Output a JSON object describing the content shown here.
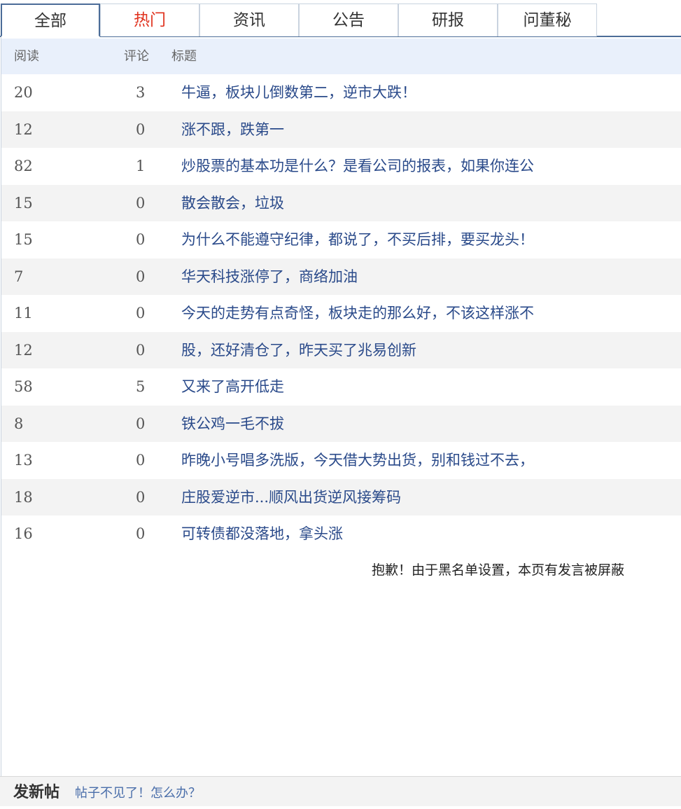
{
  "tabs": [
    {
      "label": "全部",
      "active": true
    },
    {
      "label": "热门",
      "highlight": true
    },
    {
      "label": "资讯"
    },
    {
      "label": "公告"
    },
    {
      "label": "研报"
    },
    {
      "label": "问董秘"
    }
  ],
  "table": {
    "headers": {
      "read": "阅读",
      "comment": "评论",
      "title": "标题"
    },
    "rows": [
      {
        "read": "20",
        "comment": "3",
        "title": "牛逼，板块儿倒数第二，逆市大跌！"
      },
      {
        "read": "12",
        "comment": "0",
        "title": "涨不跟，跌第一"
      },
      {
        "read": "82",
        "comment": "1",
        "title": "炒股票的基本功是什么？是看公司的报表，如果你连公"
      },
      {
        "read": "15",
        "comment": "0",
        "title": "散会散会，垃圾"
      },
      {
        "read": "15",
        "comment": "0",
        "title": "为什么不能遵守纪律，都说了，不买后排，要买龙头！"
      },
      {
        "read": "7",
        "comment": "0",
        "title": "华天科技涨停了，商络加油"
      },
      {
        "read": "11",
        "comment": "0",
        "title": "今天的走势有点奇怪，板块走的那么好，不该这样涨不"
      },
      {
        "read": "12",
        "comment": "0",
        "title": "股，还好清仓了，昨天买了兆易创新"
      },
      {
        "read": "58",
        "comment": "5",
        "title": "又来了高开低走"
      },
      {
        "read": "8",
        "comment": "0",
        "title": "铁公鸡一毛不拔"
      },
      {
        "read": "13",
        "comment": "0",
        "title": "昨晚小号唱多洗版，今天借大势出货，别和钱过不去，"
      },
      {
        "read": "18",
        "comment": "0",
        "title": "庄股爱逆市...顺风出货逆风接筹码"
      },
      {
        "read": "16",
        "comment": "0",
        "title": "可转债都没落地，拿头涨"
      }
    ]
  },
  "notice": "抱歉！由于黑名单设置，本页有发言被屏蔽",
  "footer": {
    "new_post": "发新帖",
    "help_link": "帖子不见了！怎么办？"
  },
  "colors": {
    "accent": "#4b6c98",
    "hot": "#e0321e",
    "link": "#2a4a8a",
    "header_bg": "#e9f0fb"
  }
}
